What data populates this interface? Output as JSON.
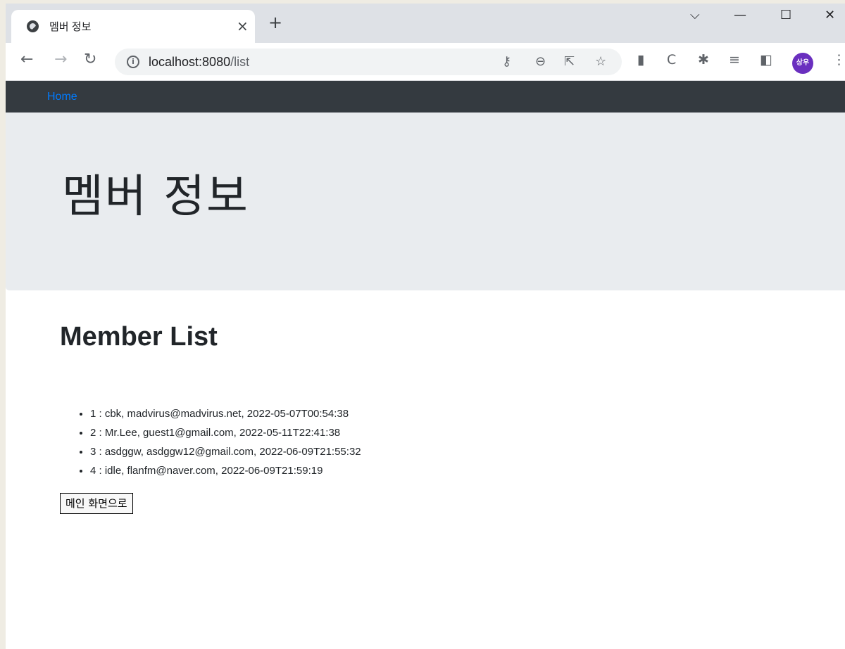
{
  "browser": {
    "tab_title": "멤버 정보",
    "tab_close": "×",
    "new_tab": "+",
    "window_controls": {
      "dropdown": "⌵",
      "minimize": "—",
      "maximize": "☐",
      "close": "✕"
    },
    "url_host": "localhost:8080",
    "url_path": "/list",
    "avatar_text": "상우",
    "avatar_color": "#6a2fbf",
    "icons": [
      "back-icon",
      "forward-icon",
      "reload-icon",
      "info-icon",
      "key-icon",
      "zoom-icon",
      "share-icon",
      "star-icon",
      "extension-barcode-icon",
      "extension-c-icon",
      "puzzle-icon",
      "reading-list-icon",
      "side-panel-icon",
      "menu-icon"
    ]
  },
  "navbar": {
    "home_label": "Home",
    "background": "#343a40",
    "link_color": "#007bff"
  },
  "jumbotron": {
    "title": "멤버 정보",
    "background": "#e9ecef"
  },
  "main": {
    "heading": "Member List",
    "members": [
      "1 : cbk, madvirus@madvirus.net, 2022-05-07T00:54:38",
      "2 : Mr.Lee, guest1@gmail.com, 2022-05-11T22:41:38",
      "3 : asdggw, asdggw12@gmail.com, 2022-06-09T21:55:32",
      "4 : idle, flanfm@naver.com, 2022-06-09T21:59:19"
    ],
    "main_button": "메인 화면으로"
  }
}
